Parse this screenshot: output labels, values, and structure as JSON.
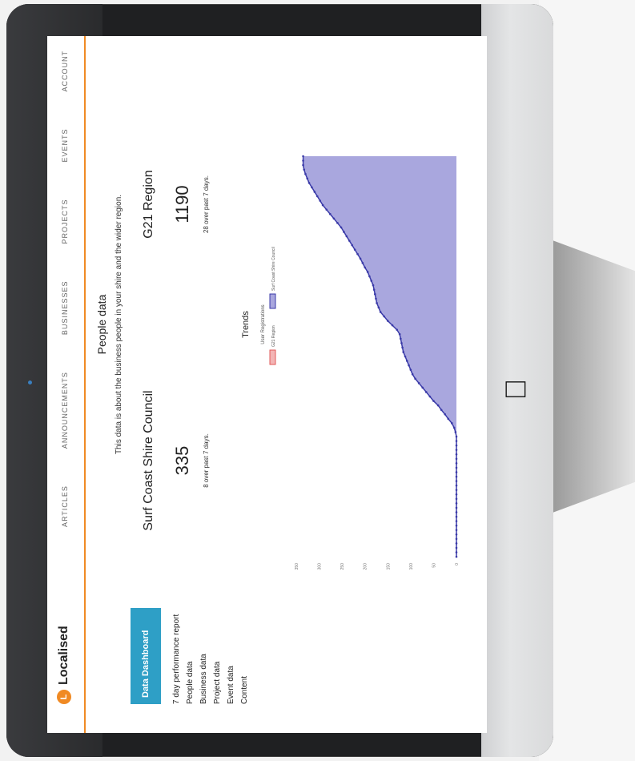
{
  "app": {
    "brand": "Localised"
  },
  "nav": [
    "ARTICLES",
    "ANNOUNCEMENTS",
    "BUSINESSES",
    "PROJECTS",
    "EVENTS",
    "ACCOUNT"
  ],
  "sidebar": {
    "active": "Data Dashboard",
    "items": [
      "7 day performance report",
      "People data",
      "Business data",
      "Project data",
      "Event data",
      "Content"
    ]
  },
  "main": {
    "title": "People data",
    "subtitle": "This data is about the business people in your shire and the wider region.",
    "stats": [
      {
        "name": "Surf Coast Shire Council",
        "value": "335",
        "note": "8 over past 7 days."
      },
      {
        "name": "G21 Region",
        "value": "1190",
        "note": "28 over past 7 days."
      }
    ],
    "trends_title": "Trends"
  },
  "chart_data": {
    "type": "area",
    "title": "User Registrations",
    "series": [
      {
        "name": "G21 Region",
        "color": "#e05a5a"
      },
      {
        "name": "Surf Coast Shire Council",
        "color": "#3a3aa8",
        "fill": "#a9a7de"
      }
    ],
    "y_ticks": [
      0,
      50,
      100,
      150,
      200,
      250,
      300,
      350
    ],
    "ylim": [
      0,
      350
    ],
    "grid": false,
    "legend": "top",
    "surf_coast_values": [
      0,
      0,
      0,
      0,
      0,
      0,
      0,
      0,
      0,
      0,
      0,
      0,
      0,
      0,
      0,
      0,
      0,
      0,
      0,
      0,
      0,
      0,
      0,
      0,
      0,
      0,
      0,
      0,
      2,
      5,
      10,
      18,
      25,
      33,
      40,
      50,
      58,
      66,
      74,
      82,
      90,
      96,
      100,
      104,
      108,
      112,
      116,
      118,
      120,
      122,
      124,
      130,
      140,
      150,
      158,
      166,
      170,
      174,
      176,
      178,
      180,
      182,
      186,
      190,
      194,
      200,
      205,
      210,
      216,
      222,
      228,
      234,
      240,
      246,
      252,
      260,
      268,
      276,
      284,
      292,
      298,
      304,
      310,
      316,
      322,
      326,
      330,
      333,
      335,
      335,
      335
    ]
  }
}
